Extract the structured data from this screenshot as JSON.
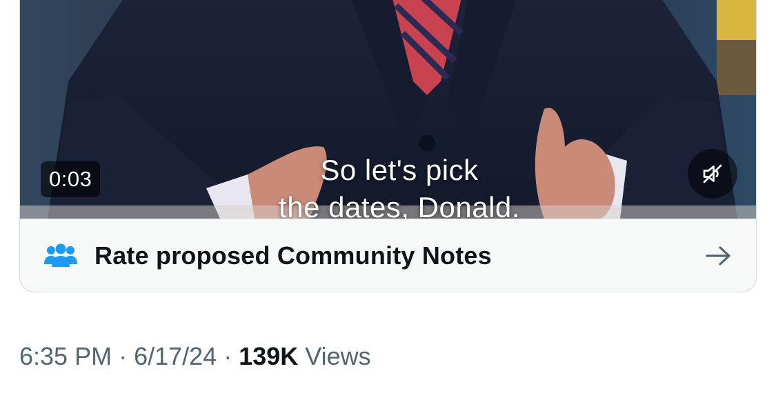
{
  "video": {
    "timestamp": "0:03",
    "caption_line1": "So let's pick",
    "caption_line2": "the dates, Donald.",
    "mute_icon": "speaker-muted-icon"
  },
  "community_notes": {
    "label": "Rate proposed Community Notes",
    "icon": "people-group-icon",
    "icon_color": "#1d9bf0",
    "arrow_icon": "arrow-right-icon"
  },
  "meta": {
    "time": "6:35 PM",
    "separator1": " · ",
    "date": "6/17/24",
    "separator2": " · ",
    "views_count": "139K",
    "views_label": " Views"
  },
  "colors": {
    "text_primary": "#0f1419",
    "text_secondary": "#536471",
    "card_border": "#cfd9de",
    "card_background": "#f7f9f9"
  }
}
